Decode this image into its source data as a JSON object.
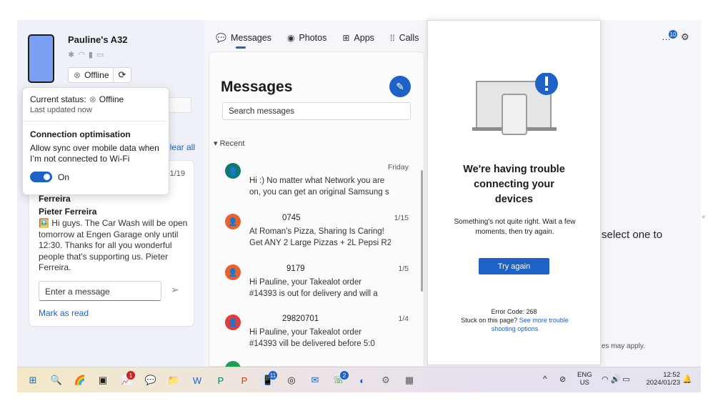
{
  "device": {
    "name": "Pauline's A32",
    "status_btn": "Offline"
  },
  "left_panel": {
    "clear_all": "Clear all"
  },
  "popup": {
    "status_label": "Current status:",
    "status_value": "Offline",
    "last_updated": "Last updated now",
    "section_title": "Connection optimisation",
    "description": "Allow sync over mobile data when I’m not connected to Wi-Fi",
    "toggle_state": "On"
  },
  "notification": {
    "date": "01/19",
    "sender_line1": "Ferreira",
    "sender_line2": "Pieter Ferreira",
    "body": "🖼️ Hi guys. The Car Wash will be open tomorrow at Engen Garage only until 12:30. Thanks for all you wonderful people that's supporting us. Pieter Ferreira.",
    "reply_placeholder": "Enter a message",
    "mark_as_read": "Mark as read"
  },
  "tabs": [
    {
      "label": "Messages",
      "icon": "chat-bubble-icon"
    },
    {
      "label": "Photos",
      "icon": "photo-icon"
    },
    {
      "label": "Apps",
      "icon": "apps-icon"
    },
    {
      "label": "Calls",
      "icon": "dialpad-icon"
    }
  ],
  "messages": {
    "title": "Messages",
    "search_placeholder": "Search messages",
    "section": "Recent",
    "conversations": [
      {
        "name": "",
        "time": "Friday",
        "line1": "Hi :) No matter what Network you are",
        "line2": "on, you can get an original Samsung s",
        "color": "#0e7a6d"
      },
      {
        "name": "0745",
        "time": "1/15",
        "line1": "At Roman's Pizza, Sharing Is Caring!",
        "line2": "Get ANY 2 Large Pizzas + 2L Pepsi R20",
        "color": "#e8622a"
      },
      {
        "name": "9179",
        "time": "1/5",
        "line1": "Hi Pauline, your Takealot order",
        "line2": "#14393          is out for delivery and will a",
        "color": "#e8622a"
      },
      {
        "name": "29820701",
        "time": "1/4",
        "line1": "Hi Pauline, your Takealot order",
        "line2": "#14393          vill be delivered before 5:0",
        "color": "#e03c3c"
      }
    ]
  },
  "right_pane": {
    "text": "select one to",
    "footer": "es may apply."
  },
  "topright": {
    "notifications_count": "10"
  },
  "error_panel": {
    "heading": "We're having trouble connecting your devices",
    "subtext": "Something's not quite right. Wait a few moments, then try again.",
    "button": "Try again",
    "error_code": "Error Code: 268",
    "stuck_text": "Stuck on this page?",
    "link_text": "See more trouble shooting options"
  },
  "taskbar": {
    "lang1": "ENG",
    "lang2": "US",
    "time": "12:52",
    "date": "2024/01/23",
    "badge_1": "1",
    "badge_11": "11",
    "badge_2": "2"
  }
}
